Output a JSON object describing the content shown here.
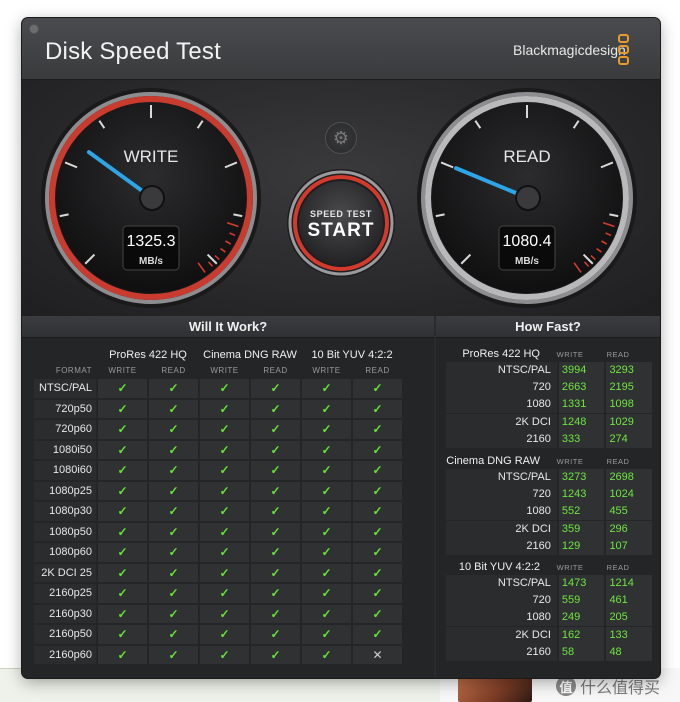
{
  "window": {
    "title": "Disk Speed Test",
    "brand": "Blackmagicdesign"
  },
  "gauges": {
    "write": {
      "label": "WRITE",
      "value": "1325.3",
      "unit": "MB/s",
      "needle_fraction": 0.3,
      "ring_color": "#c93a2f",
      "needle_color": "#2ea5e6"
    },
    "read": {
      "label": "READ",
      "value": "1080.4",
      "unit": "MB/s",
      "needle_fraction": 0.25,
      "ring_color": "#b9b9bb",
      "needle_color": "#2ea5e6"
    }
  },
  "start_button": {
    "line1": "SPEED TEST",
    "line2": "START"
  },
  "settings": {
    "icon": "gear-icon"
  },
  "will_it_work": {
    "title": "Will It Work?",
    "format_header": "FORMAT",
    "groups": [
      "ProRes 422 HQ",
      "Cinema DNG RAW",
      "10 Bit YUV 4:2:2"
    ],
    "sub_headers": [
      "WRITE",
      "READ"
    ],
    "check_glyph": "✓",
    "cross_glyph": "✕",
    "rows": [
      {
        "format": "NTSC/PAL",
        "cells": [
          true,
          true,
          true,
          true,
          true,
          true
        ]
      },
      {
        "format": "720p50",
        "cells": [
          true,
          true,
          true,
          true,
          true,
          true
        ]
      },
      {
        "format": "720p60",
        "cells": [
          true,
          true,
          true,
          true,
          true,
          true
        ]
      },
      {
        "format": "1080i50",
        "cells": [
          true,
          true,
          true,
          true,
          true,
          true
        ]
      },
      {
        "format": "1080i60",
        "cells": [
          true,
          true,
          true,
          true,
          true,
          true
        ]
      },
      {
        "format": "1080p25",
        "cells": [
          true,
          true,
          true,
          true,
          true,
          true
        ]
      },
      {
        "format": "1080p30",
        "cells": [
          true,
          true,
          true,
          true,
          true,
          true
        ]
      },
      {
        "format": "1080p50",
        "cells": [
          true,
          true,
          true,
          true,
          true,
          true
        ]
      },
      {
        "format": "1080p60",
        "cells": [
          true,
          true,
          true,
          true,
          true,
          true
        ]
      },
      {
        "format": "2K DCI 25",
        "cells": [
          true,
          true,
          true,
          true,
          true,
          true
        ]
      },
      {
        "format": "2160p25",
        "cells": [
          true,
          true,
          true,
          true,
          true,
          true
        ]
      },
      {
        "format": "2160p30",
        "cells": [
          true,
          true,
          true,
          true,
          true,
          true
        ]
      },
      {
        "format": "2160p50",
        "cells": [
          true,
          true,
          true,
          true,
          true,
          true
        ]
      },
      {
        "format": "2160p60",
        "cells": [
          true,
          true,
          true,
          true,
          true,
          false
        ]
      }
    ]
  },
  "how_fast": {
    "title": "How Fast?",
    "sub_headers": [
      "WRITE",
      "READ"
    ],
    "sections": [
      {
        "name": "ProRes 422 HQ",
        "rows": [
          {
            "label": "NTSC/PAL",
            "write": "3994",
            "read": "3293"
          },
          {
            "label": "720",
            "write": "2663",
            "read": "2195"
          },
          {
            "label": "1080",
            "write": "1331",
            "read": "1098"
          },
          {
            "label": "2K DCI",
            "write": "1248",
            "read": "1029"
          },
          {
            "label": "2160",
            "write": "333",
            "read": "274"
          }
        ]
      },
      {
        "name": "Cinema DNG RAW",
        "rows": [
          {
            "label": "NTSC/PAL",
            "write": "3273",
            "read": "2698"
          },
          {
            "label": "720",
            "write": "1243",
            "read": "1024"
          },
          {
            "label": "1080",
            "write": "552",
            "read": "455"
          },
          {
            "label": "2K DCI",
            "write": "359",
            "read": "296"
          },
          {
            "label": "2160",
            "write": "129",
            "read": "107"
          }
        ]
      },
      {
        "name": "10 Bit YUV 4:2:2",
        "rows": [
          {
            "label": "NTSC/PAL",
            "write": "1473",
            "read": "1214"
          },
          {
            "label": "720",
            "write": "559",
            "read": "461"
          },
          {
            "label": "1080",
            "write": "249",
            "read": "205"
          },
          {
            "label": "2K DCI",
            "write": "162",
            "read": "133"
          },
          {
            "label": "2160",
            "write": "58",
            "read": "48"
          }
        ]
      }
    ]
  },
  "watermark": {
    "icon": "value-icon",
    "glyph": "值",
    "text": "什么值得买"
  }
}
